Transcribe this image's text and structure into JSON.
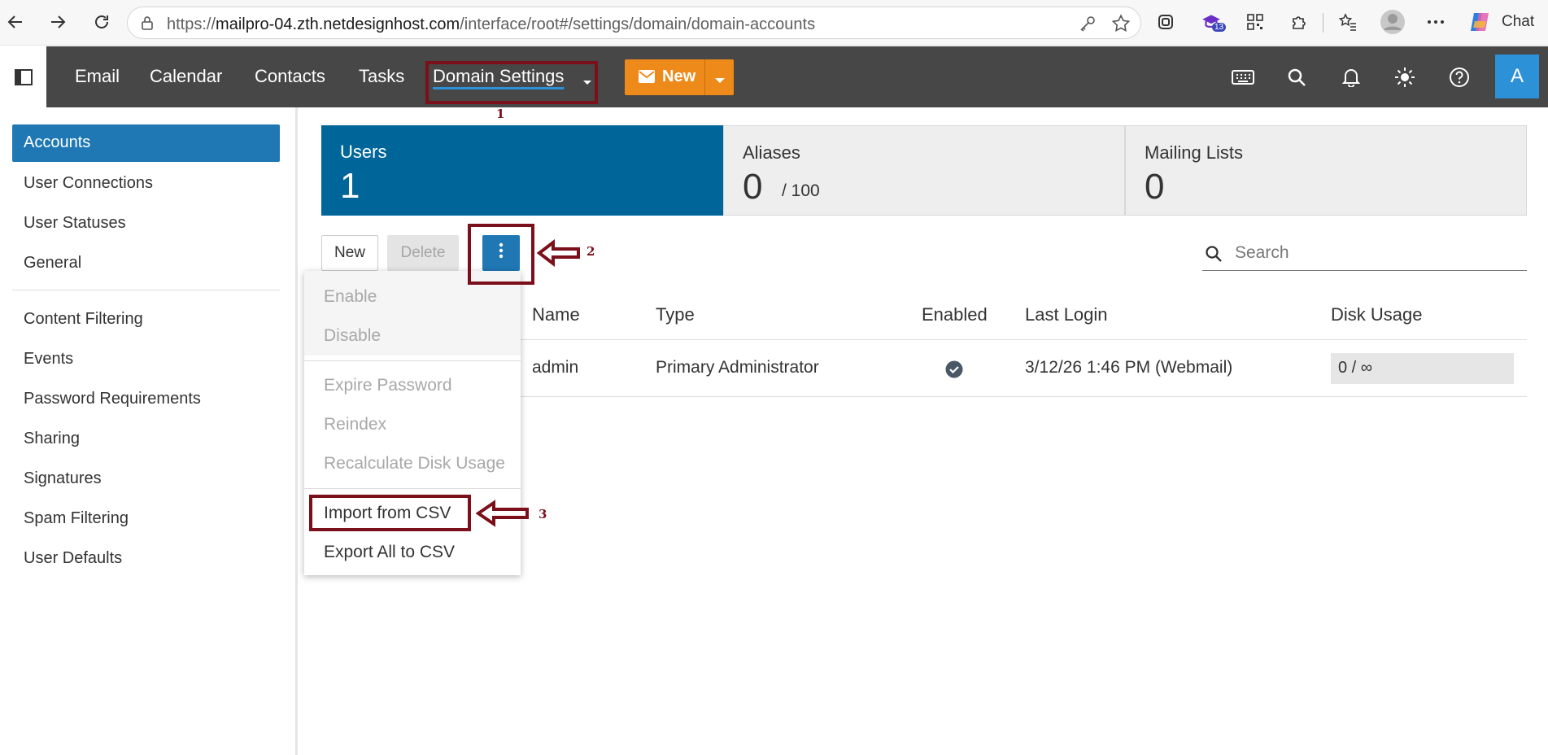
{
  "browser": {
    "url_prefix": "https://",
    "url_host": "mailpro-04.zth.netdesignhost.com",
    "url_path": "/interface/root#/settings/domain/domain-accounts",
    "badge_count": "13",
    "chat_label": "Chat"
  },
  "appbar": {
    "nav": [
      "Email",
      "Calendar",
      "Contacts",
      "Tasks",
      "Domain Settings"
    ],
    "new_label": "New",
    "avatar_letter": "A",
    "accent": "#ee8a19",
    "header_bg": "#474747"
  },
  "leftnav": {
    "items_top": [
      "Accounts",
      "User Connections",
      "User Statuses",
      "General"
    ],
    "items_bottom": [
      "Content Filtering",
      "Events",
      "Password Requirements",
      "Sharing",
      "Signatures",
      "Spam Filtering",
      "User Defaults"
    ],
    "active": "Accounts",
    "active_color": "#1f78b4"
  },
  "stats": [
    {
      "label": "Users",
      "value": "1",
      "suffix": ""
    },
    {
      "label": "Aliases",
      "value": "0",
      "suffix": "/ 100"
    },
    {
      "label": "Mailing Lists",
      "value": "0",
      "suffix": ""
    }
  ],
  "toolbar": {
    "new_label": "New",
    "delete_label": "Delete",
    "search_placeholder": "Search"
  },
  "table": {
    "columns": [
      "Name",
      "Type",
      "Enabled",
      "Last Login",
      "Disk Usage"
    ],
    "rows": [
      {
        "name": "admin",
        "type": "Primary Administrator",
        "enabled": true,
        "last_login": "3/12/26 1:46 PM (Webmail)",
        "disk_usage": "0 / ∞"
      }
    ]
  },
  "menu": {
    "items": [
      {
        "label": "Enable",
        "disabled": true
      },
      {
        "label": "Disable",
        "disabled": true
      },
      {
        "label": "Expire Password",
        "disabled": true
      },
      {
        "label": "Reindex",
        "disabled": true
      },
      {
        "label": "Recalculate Disk Usage",
        "disabled": true
      },
      {
        "label": "Import from CSV",
        "disabled": false
      },
      {
        "label": "Export All to CSV",
        "disabled": false
      }
    ]
  },
  "annotations": [
    "1",
    "2",
    "3"
  ]
}
